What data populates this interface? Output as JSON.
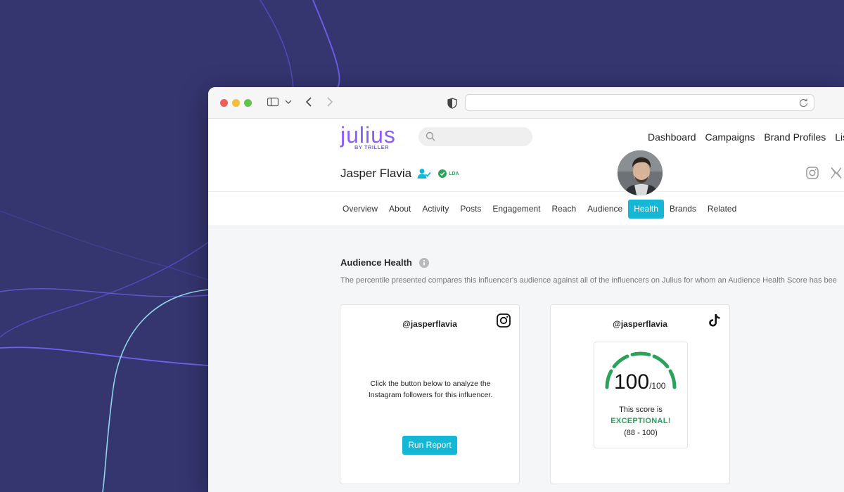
{
  "colors": {
    "accent": "#14b8d6",
    "brand": "#8b5cf6",
    "success": "#2aa35a",
    "background": "#353570"
  },
  "brand": {
    "logo_main": "julius",
    "logo_sub": "BY TRILLER"
  },
  "search": {
    "placeholder": ""
  },
  "nav": {
    "items": [
      "Dashboard",
      "Campaigns",
      "Brand Profiles",
      "Lists"
    ]
  },
  "profile": {
    "name": "Jasper Flavia",
    "badge": "LDA"
  },
  "tabs": {
    "items": [
      "Overview",
      "About",
      "Activity",
      "Posts",
      "Engagement",
      "Reach",
      "Audience",
      "Health",
      "Brands",
      "Related"
    ],
    "active": "Health"
  },
  "section": {
    "title": "Audience Health",
    "description": "The percentile presented compares this influencer's audience against all of the influencers on Julius for whom an Audience Health Score has bee"
  },
  "cards": {
    "instagram": {
      "handle": "@jasperflavia",
      "icon": "instagram-icon",
      "message": "Click the button below to analyze the Instagram followers for this influencer.",
      "button": "Run Report"
    },
    "tiktok": {
      "handle": "@jasperflavia",
      "icon": "tiktok-icon",
      "score": "100",
      "score_max": "/100",
      "score_fraction": 1.0,
      "line1": "This score is",
      "line2": "EXCEPTIONAL!",
      "line3": "(88 - 100)"
    }
  }
}
